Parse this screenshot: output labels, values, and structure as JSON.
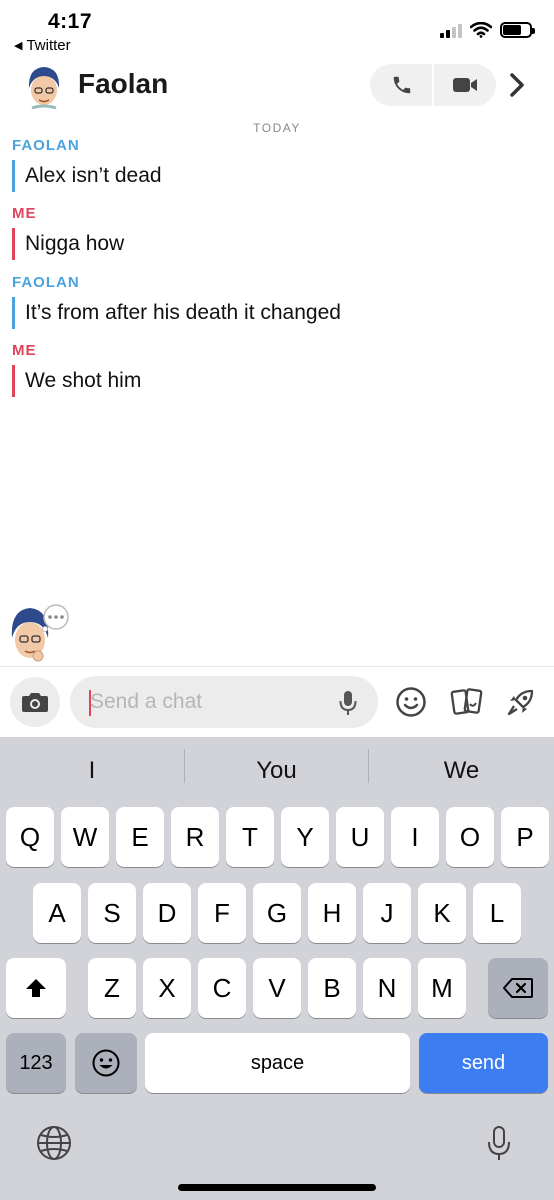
{
  "status_bar": {
    "time": "4:17",
    "back_app": "Twitter"
  },
  "header": {
    "contact_name": "Faolan"
  },
  "chat": {
    "date_divider": "TODAY",
    "messages": [
      {
        "sender": "FAOLAN",
        "text": "Alex isn’t dead"
      },
      {
        "sender": "ME",
        "text": "Nigga how"
      },
      {
        "sender": "FAOLAN",
        "text": "It’s from after his death it changed"
      },
      {
        "sender": "ME",
        "text": "We shot him"
      }
    ]
  },
  "input": {
    "placeholder": "Send a chat"
  },
  "keyboard": {
    "suggestions": [
      "I",
      "You",
      "We"
    ],
    "row1": [
      "Q",
      "W",
      "E",
      "R",
      "T",
      "Y",
      "U",
      "I",
      "O",
      "P"
    ],
    "row2": [
      "A",
      "S",
      "D",
      "F",
      "G",
      "H",
      "J",
      "K",
      "L"
    ],
    "row3": [
      "Z",
      "X",
      "C",
      "V",
      "B",
      "N",
      "M"
    ],
    "numbers_key": "123",
    "space_key": "space",
    "send_key": "send"
  },
  "colors": {
    "friend": "#4aa3df",
    "me": "#e04458",
    "send": "#3c7ef2"
  }
}
